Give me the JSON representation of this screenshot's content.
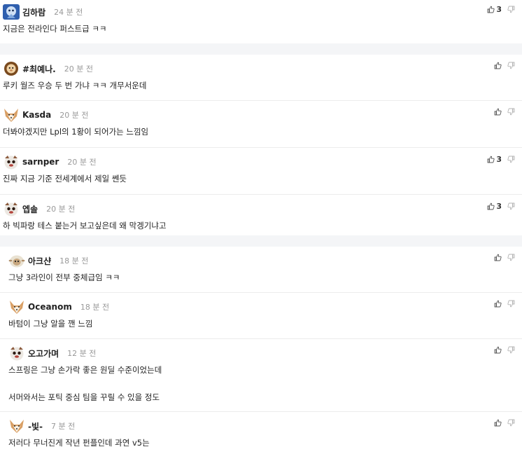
{
  "comments": [
    {
      "avatar": "blue-mascot-avatar",
      "nick": "김하람",
      "time": "24 분 전",
      "lines": [
        "지금은 전라인다 퍼스트급 ㅋㅋ"
      ],
      "likes": "3"
    },
    {
      "avatar": "lion-avatar",
      "nick": "#최예나.",
      "time": "20 분 전",
      "lines": [
        "루키 월즈 우승 두 번 가냐 ㅋㅋ 개무서운데"
      ],
      "likes": ""
    },
    {
      "avatar": "fox-avatar",
      "nick": "Kasda",
      "time": "20 분 전",
      "lines": [
        "더봐야겠지만 Lpl의 1황이 되어가는 느낌임"
      ],
      "likes": ""
    },
    {
      "avatar": "poro-avatar",
      "nick": "sarnper",
      "time": "20 분 전",
      "lines": [
        "진짜 지금 기준 전세계에서 제일 쎈듯"
      ],
      "likes": "3"
    },
    {
      "avatar": "poro-avatar",
      "nick": "엡솔",
      "time": "20 분 전",
      "lines": [
        "하 빅파랑 테스 붙는거 보고싶은데 왜 막겡기냐고"
      ],
      "likes": "3"
    },
    {
      "avatar": "sheep-avatar",
      "nick": "아크샨",
      "time": "18 분 전",
      "lines": [
        "그냥 3라인이 전부 중체급임 ㅋㅋ"
      ],
      "likes": ""
    },
    {
      "avatar": "fox-avatar",
      "nick": "Oceanom",
      "time": "18 분 전",
      "lines": [
        "바텀이 그냥 알을 깬 느낌"
      ],
      "likes": ""
    },
    {
      "avatar": "poro-avatar",
      "nick": "오고가며",
      "time": "12 분 전",
      "lines": [
        "스프링은 그냥 손가락 좋은 원딜 수준이었는데",
        "서머와서는 포틱 중심 팀을 꾸릴 수 있을 정도"
      ],
      "likes": ""
    },
    {
      "avatar": "fox-avatar",
      "nick": "-빛-",
      "time": "7 분 전",
      "lines": [
        "저러다 무너진게 작년 펀플인데 과연 v5는"
      ],
      "likes": ""
    }
  ]
}
